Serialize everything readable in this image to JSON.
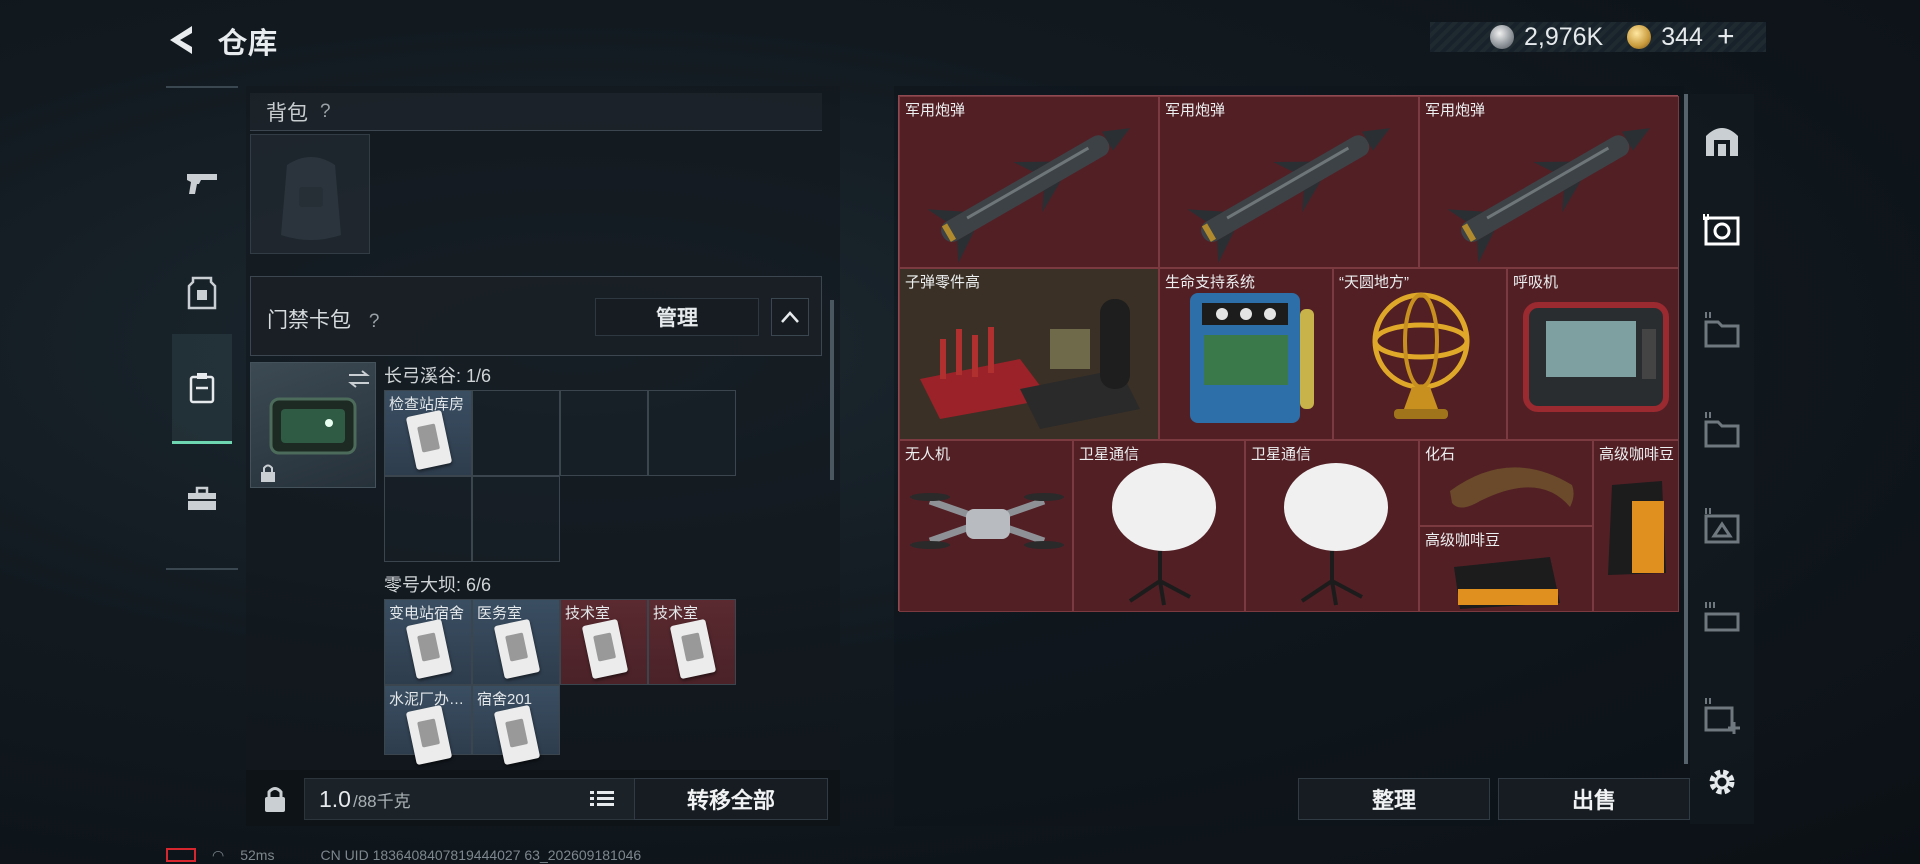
{
  "header": {
    "title": "仓库"
  },
  "currency": {
    "silver": "2,976K",
    "gold": "344",
    "plus": "+"
  },
  "left_rail": {
    "items": [
      {
        "icon": "pistol-icon"
      },
      {
        "icon": "armor-icon"
      },
      {
        "icon": "keycard-case-icon",
        "active": true
      },
      {
        "icon": "briefcase-icon"
      }
    ]
  },
  "backpack": {
    "title": "背包",
    "help": "?"
  },
  "keycard_pack": {
    "title": "门禁卡包",
    "help": "?",
    "manage_label": "管理",
    "section1": {
      "label": "长弓溪谷: 1/6",
      "cards": [
        {
          "name": "检查站库房",
          "rarity": "blue"
        }
      ]
    },
    "section2": {
      "label": "零号大坝: 6/6",
      "cards": [
        {
          "name": "变电站宿舍",
          "rarity": "blue"
        },
        {
          "name": "医务室",
          "rarity": "blue"
        },
        {
          "name": "技术室",
          "rarity": "red"
        },
        {
          "name": "技术室",
          "rarity": "red"
        },
        {
          "name": "水泥厂办…",
          "rarity": "blue"
        },
        {
          "name": "宿舍201",
          "rarity": "blue"
        }
      ]
    }
  },
  "bottom_left": {
    "weight_value": "1.0",
    "weight_max": "/88千克",
    "transfer_label": "转移全部"
  },
  "stash": {
    "items": [
      {
        "name": "军用炮弹",
        "icon": "missile-icon"
      },
      {
        "name": "军用炮弹",
        "icon": "missile-icon"
      },
      {
        "name": "军用炮弹",
        "icon": "missile-icon"
      },
      {
        "name": "子弹零件高",
        "icon": "ammo-parts-icon"
      },
      {
        "name": "生命支持系统",
        "icon": "life-support-icon"
      },
      {
        "name": "“天圆地方”",
        "icon": "armillary-sphere-icon"
      },
      {
        "name": "呼吸机",
        "icon": "ventilator-icon"
      },
      {
        "name": "无人机",
        "icon": "drone-icon"
      },
      {
        "name": "卫星通信",
        "icon": "satellite-dish-icon"
      },
      {
        "name": "卫星通信",
        "icon": "satellite-dish-icon"
      },
      {
        "name": "化石",
        "icon": "fossil-icon"
      },
      {
        "name": "高级咖啡豆",
        "icon": "coffee-bag-icon"
      },
      {
        "name": "高级咖啡豆",
        "icon": "coffee-bag-icon"
      }
    ],
    "sort_label": "整理",
    "sell_label": "出售"
  },
  "right_rail": {
    "tabs": [
      {
        "icon": "vault-icon"
      },
      {
        "icon": "storage-box-iv-icon",
        "active": true
      },
      {
        "icon": "storage-box-iv-icon"
      },
      {
        "icon": "storage-box-iv-icon"
      },
      {
        "icon": "storage-box-iv-icon"
      },
      {
        "icon": "storage-box-iii-icon"
      },
      {
        "icon": "storage-box-add-icon"
      },
      {
        "icon": "gear-icon"
      }
    ]
  },
  "status": {
    "ping": "52ms",
    "uid": "CN UID 1836408407819444027 63_202609181046"
  },
  "colors": {
    "accent": "#6fd6b2",
    "rarity_red": "#5a262b",
    "rarity_blue": "#3a4e62"
  }
}
